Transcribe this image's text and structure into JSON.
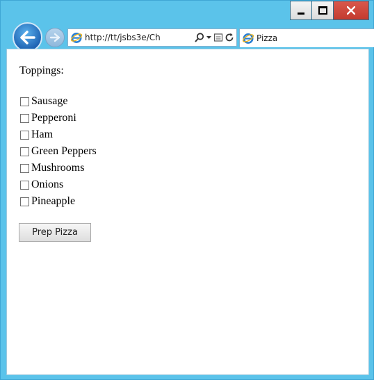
{
  "browser": {
    "address_url": "http://tt/jsbs3e/Ch",
    "tab_title": "Pizza",
    "icons": [
      "back-arrow",
      "forward-arrow",
      "ie-logo",
      "search",
      "dropdown",
      "compatibility",
      "refresh",
      "minimize",
      "maximize",
      "close"
    ]
  },
  "page": {
    "heading": "Toppings:",
    "toppings": [
      "Sausage",
      "Pepperoni",
      "Ham",
      "Green Peppers",
      "Mushrooms",
      "Onions",
      "Pineapple"
    ],
    "checked": [
      false,
      false,
      false,
      false,
      false,
      false,
      false
    ],
    "button_label": "Prep Pizza"
  },
  "colors": {
    "frame": "#5bc3ea",
    "close_button": "#c83f33",
    "back_button": "#1a5fb0"
  }
}
